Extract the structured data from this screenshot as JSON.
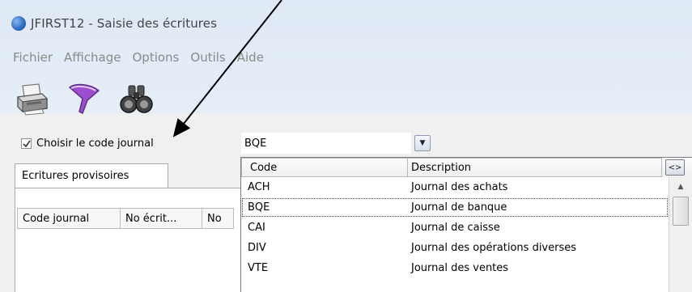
{
  "window": {
    "title": "JFIRST12 - Saisie des écritures"
  },
  "menubar": {
    "items": [
      "Fichier",
      "Affichage",
      "Options",
      "Outils",
      "Aide"
    ]
  },
  "toolbar": {
    "buttons": [
      {
        "icon": "printer-icon"
      },
      {
        "icon": "funnel-filter-icon"
      },
      {
        "icon": "binoculars-icon"
      }
    ]
  },
  "journal_filter": {
    "checkbox_label": "Choisir le code journal",
    "checked": true,
    "combo_value": "BQE"
  },
  "tabs": [
    {
      "label": "Ecritures provisoires"
    }
  ],
  "grid": {
    "columns": [
      "Code journal",
      "No écrit...",
      "No"
    ]
  },
  "dropdown": {
    "headers": {
      "code": "Code",
      "description": "Description",
      "toggle": "<>"
    },
    "rows": [
      {
        "code": "ACH",
        "description": "Journal des achats"
      },
      {
        "code": "BQE",
        "description": "Journal de banque",
        "selected": true
      },
      {
        "code": "CAI",
        "description": "Journal de caisse"
      },
      {
        "code": "DIV",
        "description": "Journal des opérations diverses"
      },
      {
        "code": "VTE",
        "description": "Journal des ventes"
      }
    ]
  },
  "colors": {
    "title_bar_bg": "#dfe9f5",
    "window_bg": "#f0f0f0",
    "menu_text": "#8a8a8a"
  }
}
